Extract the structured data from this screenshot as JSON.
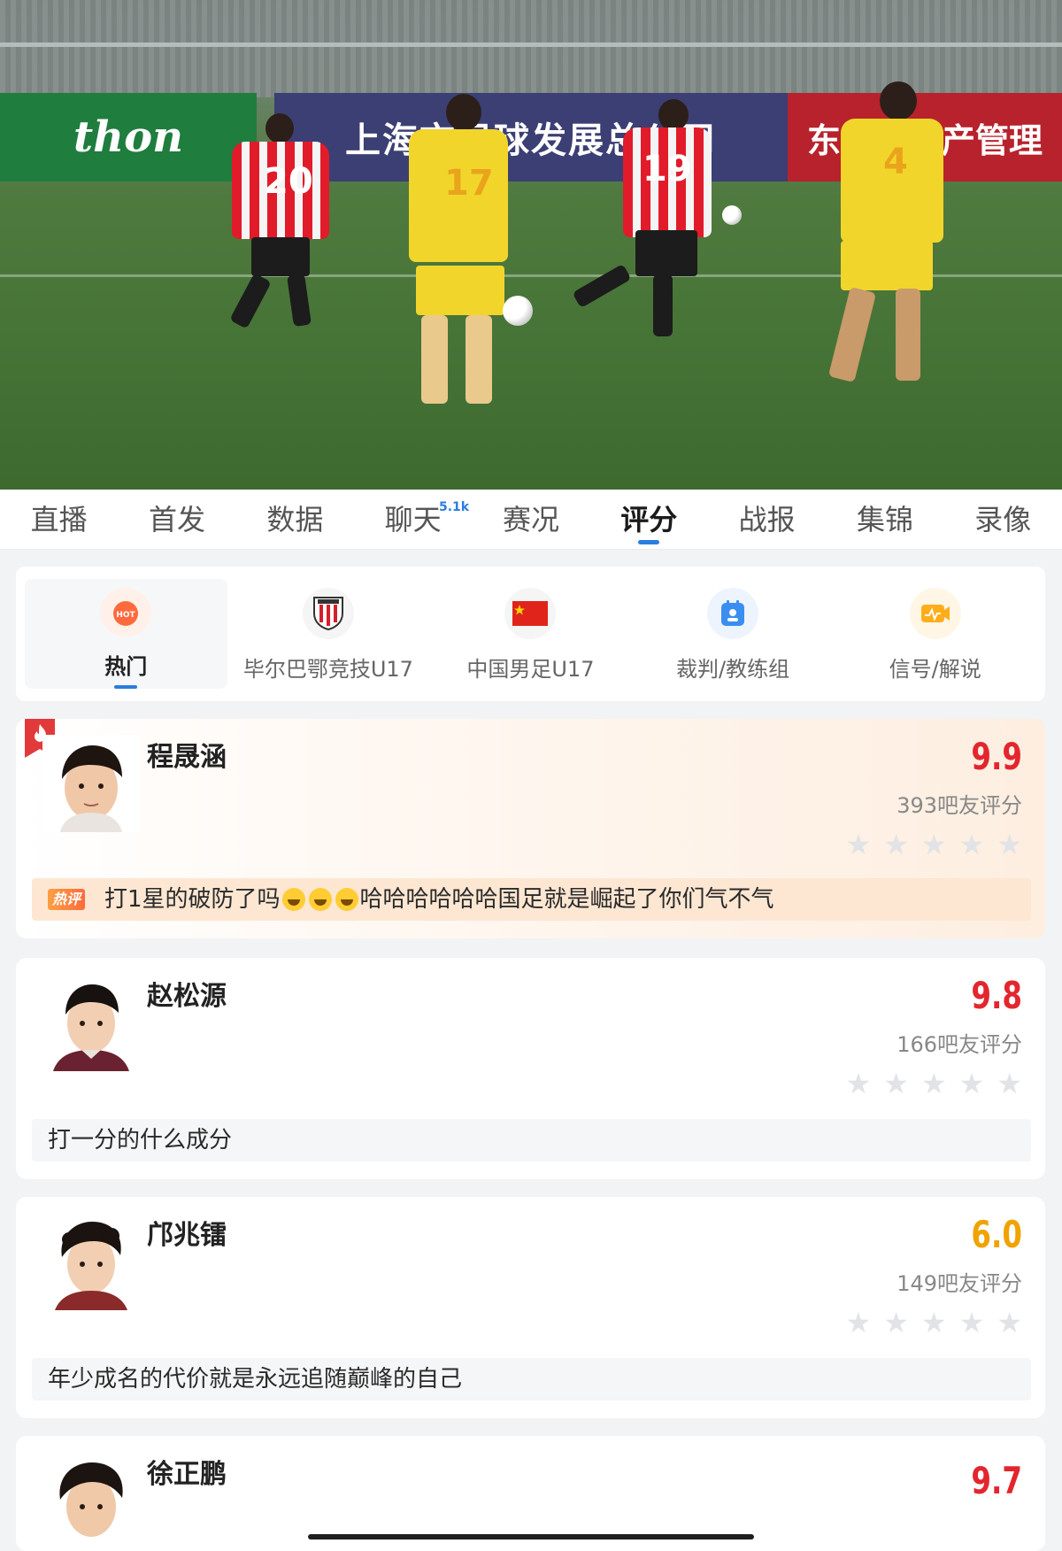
{
  "video": {
    "banners": [
      "thon",
      "上海市足球发展总公司",
      "东方红资产管理"
    ],
    "shirt_numbers": [
      "20",
      "19",
      "17",
      "4"
    ]
  },
  "tabs": [
    {
      "label": "直播"
    },
    {
      "label": "首发"
    },
    {
      "label": "数据"
    },
    {
      "label": "聊天",
      "badge": "5.1k"
    },
    {
      "label": "赛况"
    },
    {
      "label": "评分",
      "active": true
    },
    {
      "label": "战报"
    },
    {
      "label": "集锦"
    },
    {
      "label": "录像"
    }
  ],
  "categories": [
    {
      "label": "热门",
      "icon": "hot-icon",
      "icon_text": "HOT",
      "active": true
    },
    {
      "label": "毕尔巴鄂竞技U17",
      "icon": "athletic-bilbao-crest-icon"
    },
    {
      "label": "中国男足U17",
      "icon": "china-flag-icon"
    },
    {
      "label": "裁判/教练组",
      "icon": "referee-badge-icon"
    },
    {
      "label": "信号/解说",
      "icon": "broadcast-signal-icon"
    }
  ],
  "ratings": [
    {
      "name": "程晟涵",
      "score": "9.9",
      "count": "393吧友评分",
      "hot": true,
      "hot_tag": "热评",
      "comment_pre": "打1星的破防了吗",
      "comment_post": "哈哈哈哈哈哈国足就是崛起了你们气不气",
      "emoji_count": 3
    },
    {
      "name": "赵松源",
      "score": "9.8",
      "count": "166吧友评分",
      "comment": "打一分的什么成分"
    },
    {
      "name": "邝兆镭",
      "score": "6.0",
      "count": "149吧友评分",
      "comment": "年少成名的代价就是永远追随巅峰的自己"
    },
    {
      "name": "徐正鹏",
      "score": "9.7"
    }
  ],
  "colors": {
    "accent_blue": "#2a7de1",
    "score_red": "#e3262e",
    "score_orange": "#f0a300",
    "hot_red": "#e23a3a"
  }
}
